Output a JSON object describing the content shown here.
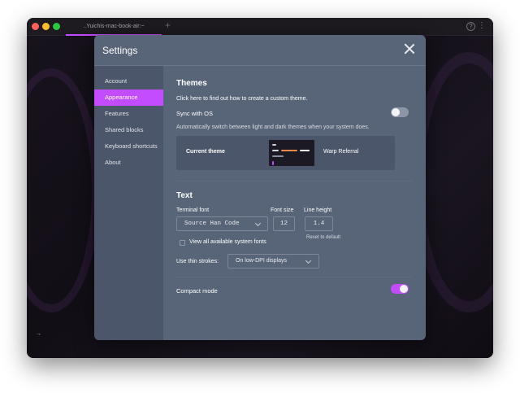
{
  "window": {
    "tab_title": "..Yuichis-mac-book-air:~",
    "tab_add": "+",
    "help_glyph": "?",
    "menu_glyph": "⋮",
    "prompt_glyph": "→"
  },
  "settings": {
    "title": "Settings",
    "sidebar": {
      "items": [
        {
          "label": "Account",
          "active": false
        },
        {
          "label": "Appearance",
          "active": true
        },
        {
          "label": "Features",
          "active": false
        },
        {
          "label": "Shared blocks",
          "active": false
        },
        {
          "label": "Keyboard shortcuts",
          "active": false
        },
        {
          "label": "About",
          "active": false
        }
      ]
    },
    "themes": {
      "heading": "Themes",
      "custom_link": "Click here to find out how to create a custom theme.",
      "sync_label": "Sync with OS",
      "sync_on": false,
      "sync_description": "Automatically switch between light and dark themes when your system does.",
      "current_theme_label": "Current theme",
      "current_theme_name": "Warp Referral"
    },
    "text": {
      "heading": "Text",
      "terminal_font_label": "Terminal font",
      "terminal_font_value": "Source Han Code",
      "font_size_label": "Font size",
      "font_size_value": "12",
      "line_height_label": "Line height",
      "line_height_value": "1.4",
      "reset_label": "Reset to default",
      "view_all_fonts_label": "View all available system fonts",
      "view_all_fonts_checked": false,
      "thin_strokes_label": "Use thin strokes:",
      "thin_strokes_value": "On low-DPI displays"
    },
    "compact": {
      "label": "Compact mode",
      "on": true
    }
  },
  "colors": {
    "accent": "#c44cff",
    "modal_bg": "#586478",
    "sidebar_bg": "#4c566a",
    "terminal_bg": "#14101a"
  }
}
